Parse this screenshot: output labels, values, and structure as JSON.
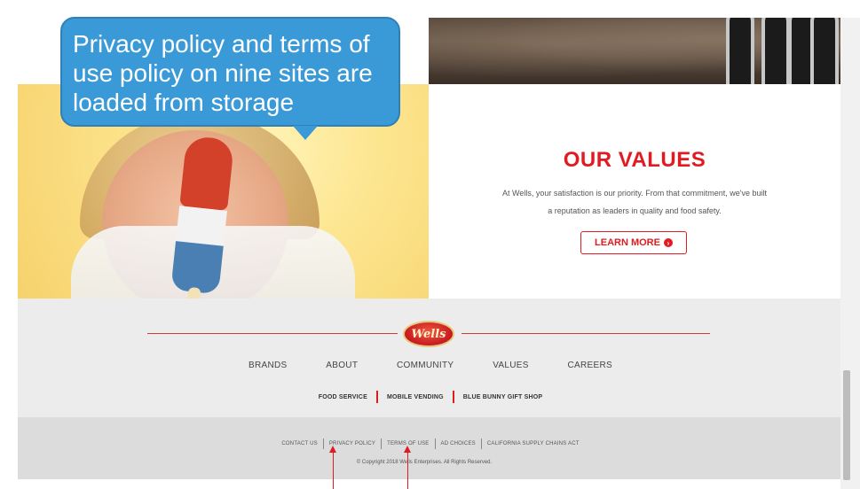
{
  "callout": {
    "text": "Privacy policy and terms of use policy on nine sites are loaded from storage"
  },
  "values": {
    "title": "OUR VALUES",
    "description": "At Wells, your satisfaction is our priority. From that commitment, we've built a reputation as leaders in quality and food safety.",
    "button_label": "LEARN MORE"
  },
  "footer": {
    "logo_text": "Wells",
    "main_nav": [
      "BRANDS",
      "ABOUT",
      "COMMUNITY",
      "VALUES",
      "CAREERS"
    ],
    "sub_nav": [
      "FOOD SERVICE",
      "MOBILE VENDING",
      "BLUE BUNNY GIFT SHOP"
    ],
    "legal_nav": [
      "CONTACT US",
      "PRIVACY POLICY",
      "TERMS OF USE",
      "AD CHOICES",
      "CALIFORNIA SUPPLY CHAINS ACT"
    ],
    "copyright": "© Copyright 2018 Wells Enterprises. All Rights Reserved."
  },
  "colors": {
    "accent_red": "#e11b22",
    "callout_blue": "#3a9ad8",
    "footer_light": "#ececec",
    "footer_dark": "#dcdcdc"
  },
  "icons": {
    "learn_more_arrow": "chevron-circle-right-icon"
  }
}
